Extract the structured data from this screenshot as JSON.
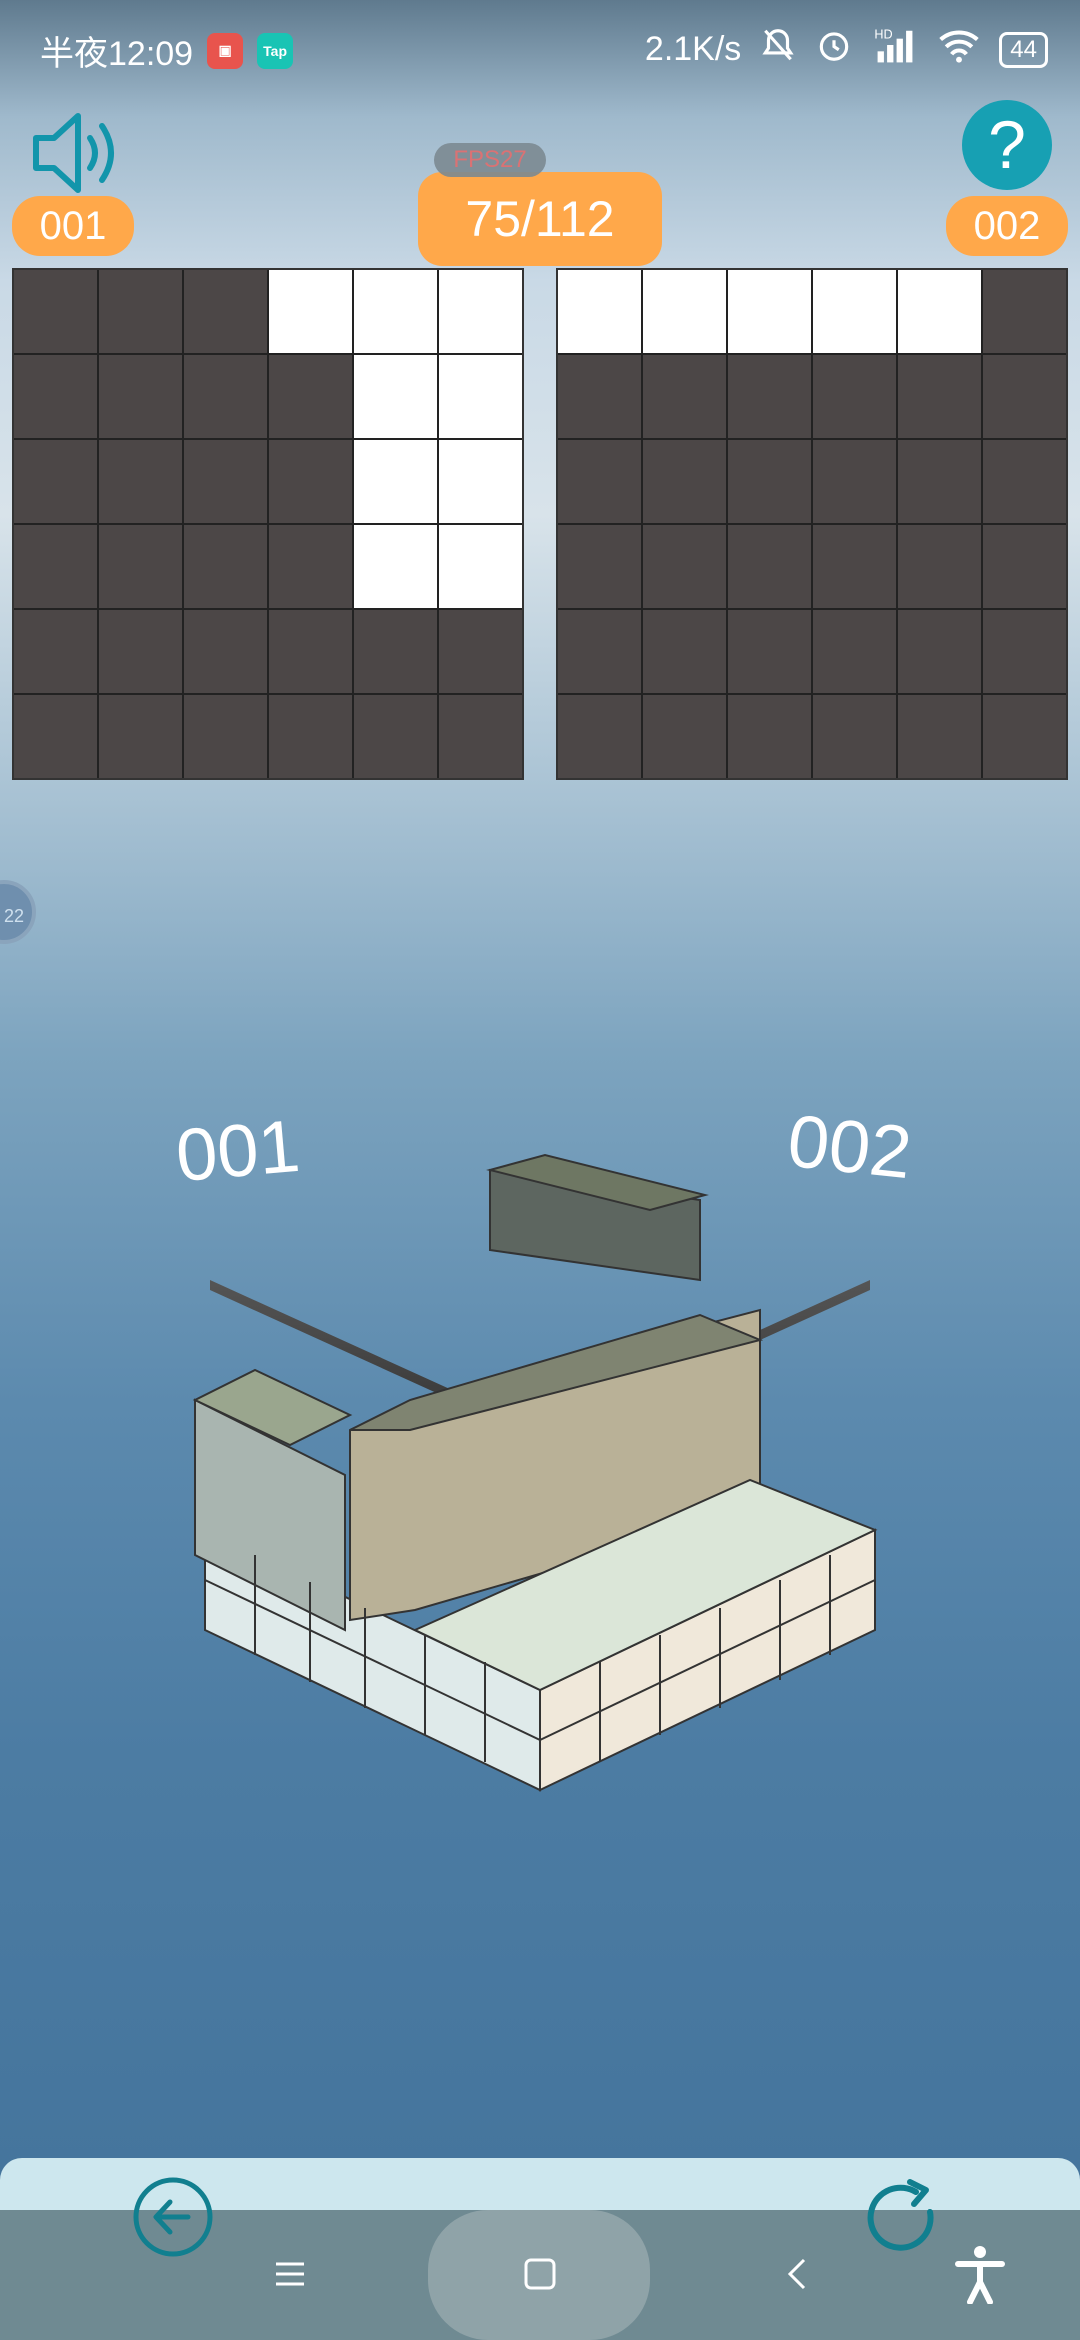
{
  "status_bar": {
    "time": "半夜12:09",
    "app_icons": [
      "game-app-icon",
      "tap-app-icon"
    ],
    "tap_label": "Tap",
    "network_speed": "2.1K/s",
    "battery": "44",
    "hd_label": "HD"
  },
  "hud": {
    "sound_icon": "speaker-icon",
    "help_icon": "question-icon",
    "help_label": "?",
    "left_view_label": "001",
    "right_view_label": "002",
    "fps": "FPS27",
    "progress": "75/112"
  },
  "grids": {
    "left": [
      [
        1,
        1,
        1,
        0,
        0,
        0
      ],
      [
        1,
        1,
        1,
        1,
        0,
        0
      ],
      [
        1,
        1,
        1,
        1,
        0,
        0
      ],
      [
        1,
        1,
        1,
        1,
        0,
        0
      ],
      [
        1,
        1,
        1,
        1,
        1,
        1
      ],
      [
        1,
        1,
        1,
        1,
        1,
        1
      ]
    ],
    "right": [
      [
        0,
        0,
        0,
        0,
        0,
        1
      ],
      [
        1,
        1,
        1,
        1,
        1,
        1
      ],
      [
        1,
        1,
        1,
        1,
        1,
        1
      ],
      [
        1,
        1,
        1,
        1,
        1,
        1
      ],
      [
        1,
        1,
        1,
        1,
        1,
        1
      ],
      [
        1,
        1,
        1,
        1,
        1,
        1
      ]
    ]
  },
  "scene": {
    "left_label": "001",
    "right_label": "002"
  },
  "side_knob_label": "22",
  "bottom_bar": {
    "back_icon": "arrow-left-circle-icon",
    "reset_icon": "refresh-icon"
  },
  "nav": {
    "menu_icon": "menu-icon",
    "home_icon": "home-square-icon",
    "back_icon": "chevron-left-icon",
    "accessibility_icon": "accessibility-icon"
  },
  "colors": {
    "accent": "#ffa84a",
    "help": "#17a0b3",
    "dark_cell": "#4c4747",
    "light_cell": "#ffffff"
  }
}
